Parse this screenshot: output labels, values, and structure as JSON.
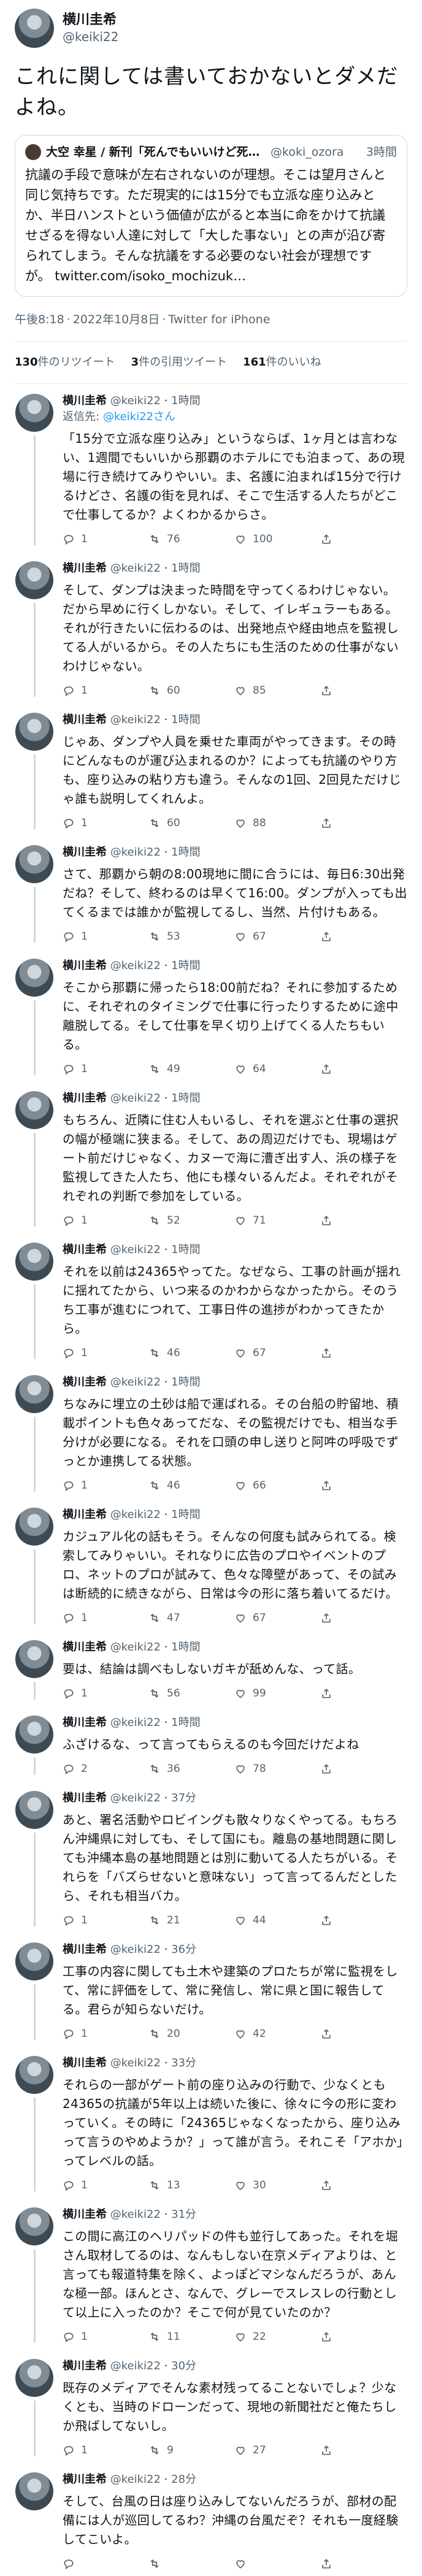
{
  "main": {
    "name": "横川圭希",
    "handle": "@keiki22",
    "text": "これに関しては書いておかないとダメだよね。",
    "quote": {
      "name": "大空 幸星 / 新刊「死んでもいいけど死んじゃ…",
      "handle": "@koki_ozora",
      "time": "3時間",
      "text": "抗議の手段で意味が左右されないのが理想。そこは望月さんと同じ気持ちです。ただ現実的には15分でも立派な座り込みとか、半日ハンストという価値が広がると本当に命をかけて抗議せざるを得ない人達に対して「大した事ない」との声が沿び寄られてしまう。そんな抗議をする必要のない社会が理想ですが。 twitter.com/isoko_mochizuk…"
    },
    "time": "午後8:18",
    "date": "2022年10月8日",
    "client": "Twitter for iPhone",
    "stats": {
      "retweets_num": "130",
      "retweets_label": "件のリツイート",
      "quotes_num": "3",
      "quotes_label": "件の引用ツイート",
      "likes_num": "161",
      "likes_label": "件のいいね"
    }
  },
  "replies": [
    {
      "name": "横川圭希",
      "handle": "@keiki22",
      "time": "1時間",
      "reply_to_prefix": "返信先:",
      "reply_to": "@keiki22さん",
      "text": "「15分で立派な座り込み」というならば、1ヶ月とは言わない、1週間でもいいから那覇のホテルにでも泊まって、あの現場に行き続けてみりやいい。ま、名護に泊まれば15分で行けるけどさ、名護の街を見れば、そこで生活する人たちがどこで仕事してるか？よくわかるからさ。",
      "replies": "1",
      "retweets": "76",
      "likes": "100"
    },
    {
      "name": "横川圭希",
      "handle": "@keiki22",
      "time": "1時間",
      "text": "そして、ダンプは決まった時間を守ってくるわけじゃない。だから早めに行くしかない。そして、イレギュラーもある。それが行きたいに伝わるのは、出発地点や経由地点を監視してる人がいるから。その人たちにも生活のための仕事がないわけじゃない。",
      "replies": "1",
      "retweets": "60",
      "likes": "85"
    },
    {
      "name": "横川圭希",
      "handle": "@keiki22",
      "time": "1時間",
      "text": "じゃあ、ダンプや人員を乗せた車両がやってきます。その時にどんなものが運び込まれるのか？によっても抗議のやり方も、座り込みの粘り方も違う。そんなの1回、2回見ただけじゃ誰も説明してくれんよ。",
      "replies": "1",
      "retweets": "60",
      "likes": "88"
    },
    {
      "name": "横川圭希",
      "handle": "@keiki22",
      "time": "1時間",
      "text": "さて、那覇から朝の8:00現地に間に合うには、毎日6:30出発だね？そして、終わるのは早くて16:00。ダンプが入っても出てくるまでは誰かが監視してるし、当然、片付けもある。",
      "replies": "1",
      "retweets": "53",
      "likes": "67"
    },
    {
      "name": "横川圭希",
      "handle": "@keiki22",
      "time": "1時間",
      "text": "そこから那覇に帰ったら18:00前だね？それに参加するために、それぞれのタイミングで仕事に行ったりするために途中離脱してる。そして仕事を早く切り上げてくる人たちもいる。",
      "replies": "1",
      "retweets": "49",
      "likes": "64"
    },
    {
      "name": "横川圭希",
      "handle": "@keiki22",
      "time": "1時間",
      "text": "もちろん、近隣に住む人もいるし、それを選ぶと仕事の選択の幅が極端に狭まる。そして、あの周辺だけでも、現場はゲート前だけじゃなく、カヌーで海に漕ぎ出す人、浜の様子を監視してきた人たち、他にも様々いるんだよ。それぞれがそれぞれの判断で参加をしている。",
      "replies": "1",
      "retweets": "52",
      "likes": "71"
    },
    {
      "name": "横川圭希",
      "handle": "@keiki22",
      "time": "1時間",
      "text": "それを以前は24365やってた。なぜなら、工事の計画が揺れに揺れてたから、いつ来るのかわからなかったから。そのうち工事が進むにつれて、工事日件の進捗がわかってきたから。",
      "replies": "1",
      "retweets": "46",
      "likes": "67"
    },
    {
      "name": "横川圭希",
      "handle": "@keiki22",
      "time": "1時間",
      "text": "ちなみに埋立の土砂は船で運ばれる。その台船の貯留地、積載ポイントも色々あってだな、その監視だけでも、相当な手分けが必要になる。それを口頭の申し送りと阿吽の呼吸でずっとか連携してる状態。",
      "replies": "1",
      "retweets": "46",
      "likes": "66"
    },
    {
      "name": "横川圭希",
      "handle": "@keiki22",
      "time": "1時間",
      "text": "カジュアル化の話もそう。そんなの何度も試みられてる。検索してみりゃいい。それなりに広告のプロやイベントのプロ、ネットのプロが試みて、色々な障壁があって、その試みは断続的に続きながら、日常は今の形に落ち着いてるだけ。",
      "replies": "1",
      "retweets": "47",
      "likes": "67"
    },
    {
      "name": "横川圭希",
      "handle": "@keiki22",
      "time": "1時間",
      "text": "要は、結論は調べもしないガキが舐めんな、って話。",
      "replies": "1",
      "retweets": "56",
      "likes": "99"
    },
    {
      "name": "横川圭希",
      "handle": "@keiki22",
      "time": "1時間",
      "text": "ふざけるな、って言ってもらえるのも今回だけだよね",
      "replies": "2",
      "retweets": "36",
      "likes": "78"
    },
    {
      "name": "横川圭希",
      "handle": "@keiki22",
      "time": "37分",
      "text": "あと、署名活動やロビイングも散々りなくやってる。もちろん沖縄県に対しても、そして国にも。離島の基地問題に関しても沖縄本島の基地問題とは別に動いてる人たちがいる。それらを「バズらせないと意味ない」って言ってるんだとしたら、それも相当バカ。",
      "replies": "1",
      "retweets": "21",
      "likes": "44"
    },
    {
      "name": "横川圭希",
      "handle": "@keiki22",
      "time": "36分",
      "text": "工事の内容に関しても土木や建築のプロたちが常に監視をして、常に評価をして、常に発信し、常に県と国に報告してる。君らが知らないだけ。",
      "replies": "1",
      "retweets": "20",
      "likes": "42"
    },
    {
      "name": "横川圭希",
      "handle": "@keiki22",
      "time": "33分",
      "text": "それらの一部がゲート前の座り込みの行動で、少なくとも24365の抗議が5年以上は続いた後に、徐々に今の形に変わっていく。その時に「24365じゃなくなったから、座り込みって言うのやめようか？」って誰が言う。それこそ「アホか」ってレベルの話。",
      "replies": "1",
      "retweets": "13",
      "likes": "30"
    },
    {
      "name": "横川圭希",
      "handle": "@keiki22",
      "time": "31分",
      "text": "この間に高江のヘリパッドの件も並行してあった。それを堀さん取材してるのは、なんもしない在京メディアよりは、と言っても報道特集を除く、よっぽどマシなんだろうが、あんな極一部。ほんとさ、なんで、グレーでスレスレの行動として以上に入ったのか？そこで何が見ていたのか？",
      "replies": "1",
      "retweets": "11",
      "likes": "22"
    },
    {
      "name": "横川圭希",
      "handle": "@keiki22",
      "time": "30分",
      "text": "既存のメディアでそんな素材残ってることないでしょ？少なくとも、当時のドローンだって、現地の新聞社だと俺たちしか飛ばしてないし。",
      "replies": "1",
      "retweets": "9",
      "likes": "27"
    },
    {
      "name": "横川圭希",
      "handle": "@keiki22",
      "time": "28分",
      "text": "そして、台風の日は座り込みしてないんだろうが、部材の配備には人が巡回してるわ？沖縄の台風だぞ？それも一度経験してこいよ。",
      "replies": "",
      "retweets": "",
      "likes": ""
    }
  ]
}
